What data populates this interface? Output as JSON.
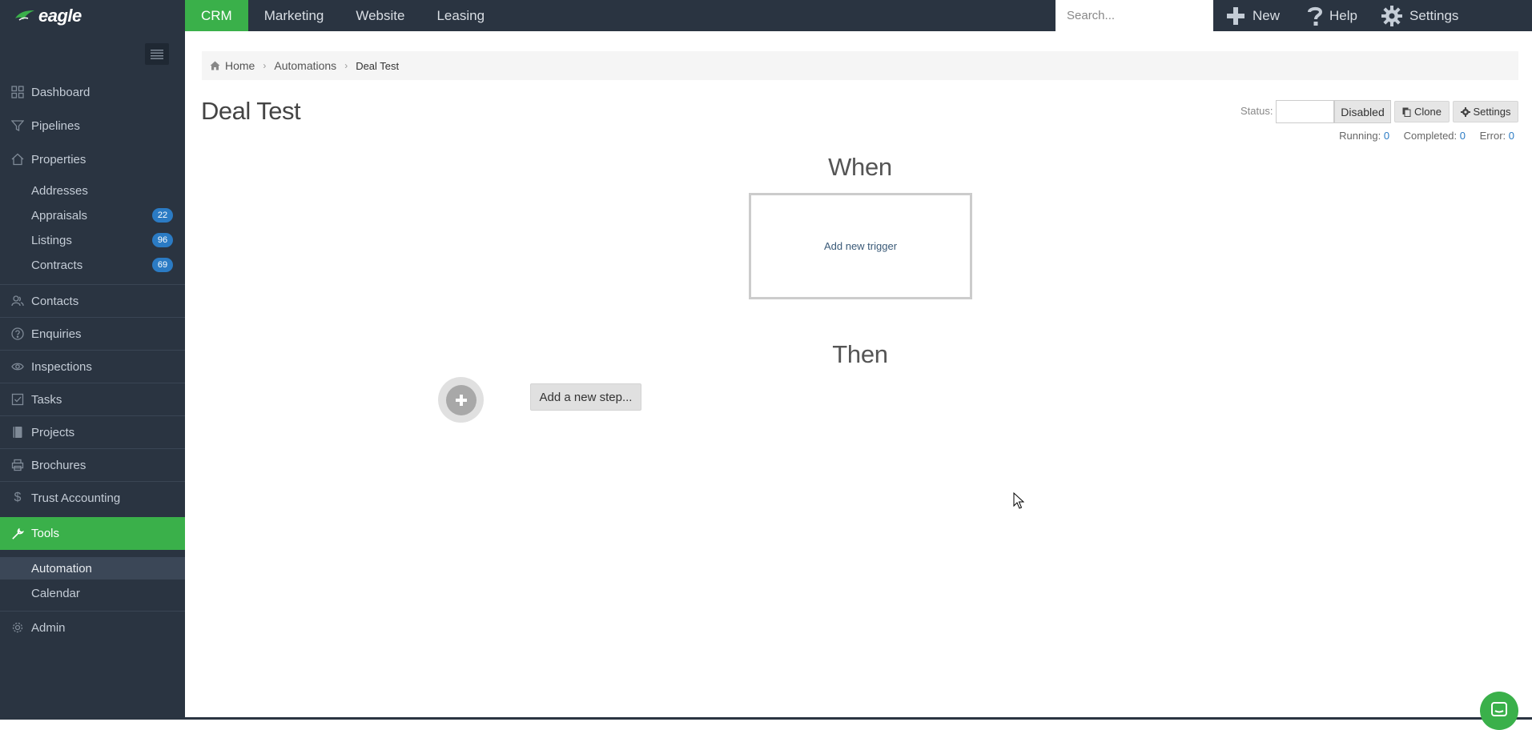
{
  "app": {
    "logo_text": "eagle"
  },
  "topnav": {
    "tabs": [
      {
        "label": "CRM",
        "active": true
      },
      {
        "label": "Marketing"
      },
      {
        "label": "Website"
      },
      {
        "label": "Leasing"
      }
    ],
    "search_placeholder": "Search...",
    "new_label": "New",
    "help_label": "Help",
    "settings_label": "Settings"
  },
  "sidebar": {
    "items": [
      {
        "label": "Dashboard",
        "icon": "dashboard-icon"
      },
      {
        "label": "Pipelines",
        "icon": "filter-icon"
      },
      {
        "label": "Properties",
        "icon": "home-icon"
      },
      {
        "label": "Addresses"
      },
      {
        "label": "Appraisals",
        "badge": "22"
      },
      {
        "label": "Listings",
        "badge": "96"
      },
      {
        "label": "Contracts",
        "badge": "69"
      },
      {
        "label": "Contacts",
        "icon": "contacts-icon"
      },
      {
        "label": "Enquiries",
        "icon": "question-icon"
      },
      {
        "label": "Inspections",
        "icon": "eye-icon"
      },
      {
        "label": "Tasks",
        "icon": "checkbox-icon"
      },
      {
        "label": "Projects",
        "icon": "book-icon"
      },
      {
        "label": "Brochures",
        "icon": "printer-icon"
      },
      {
        "label": "Trust Accounting",
        "icon": "dollar-icon"
      },
      {
        "label": "Tools",
        "icon": "wrench-icon",
        "active": true
      },
      {
        "label": "Automation",
        "active": true
      },
      {
        "label": "Calendar"
      },
      {
        "label": "Admin",
        "icon": "gear-icon"
      }
    ]
  },
  "breadcrumb": {
    "home": "Home",
    "automations": "Automations",
    "current": "Deal Test"
  },
  "page": {
    "title": "Deal Test"
  },
  "status": {
    "label": "Status:",
    "value": "Disabled"
  },
  "actions": {
    "clone_label": "Clone",
    "settings_label": "Settings"
  },
  "stats": {
    "running_label": "Running:",
    "running": "0",
    "completed_label": "Completed:",
    "completed": "0",
    "error_label": "Error:",
    "error": "0"
  },
  "workflow": {
    "when_title": "When",
    "trigger_label": "Add new trigger",
    "then_title": "Then",
    "add_step_label": "Add a new step..."
  },
  "colors": {
    "sidebar": "#2a3441",
    "accent": "#3ab04a",
    "badge": "#2b7bc4"
  }
}
